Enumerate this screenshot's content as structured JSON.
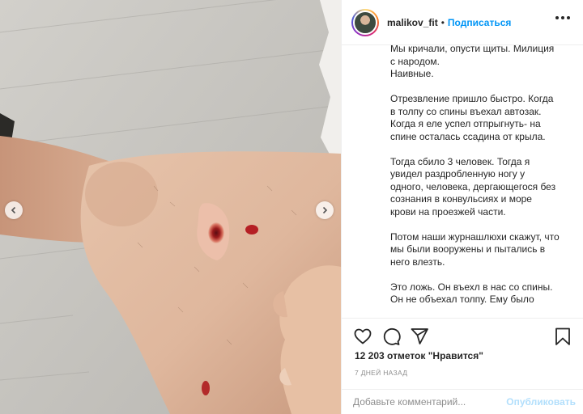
{
  "photo": {
    "icons": [
      "chevron-left-icon",
      "chevron-right-icon"
    ]
  },
  "header": {
    "username": "malikov_fit",
    "separator": "•",
    "follow_label": "Подписаться",
    "more_icon": "more-horizontal-icon"
  },
  "caption": {
    "paragraphs": [
      "Мы кричали, опусти щиты. Милиция с народом.\nНаивные.",
      "Отрезвление пришло быстро. Когда в толпу со спины въехал автозак. Когда я еле успел отпрыгнуть- на спине осталась ссадина от крыла.",
      "Тогда сбило 3 человек. Тогда я увидел раздробленную ногу у одного, человека, дергающегося без сознания в конвульсиях и море крови на проезжей части.",
      "Потом наши журнашлюхи скажут, что мы были вооружены и пытались в него влезть.",
      "Это ложь. Он въехл в нас со спины. Он не объехал толпу. Ему было"
    ]
  },
  "actions": {
    "icons": [
      "heart-icon",
      "comment-icon",
      "share-icon",
      "bookmark-icon"
    ]
  },
  "likes_text": "12 203 отметок \"Нравится\"",
  "time_text": "7 дней назад",
  "comment": {
    "placeholder": "Добавьте комментарий...",
    "publish_label": "Опубликовать"
  },
  "colors": {
    "accent": "#0095f6",
    "publish_disabled": "#b2dffc",
    "text": "#262626",
    "muted": "#8e8e8e"
  }
}
